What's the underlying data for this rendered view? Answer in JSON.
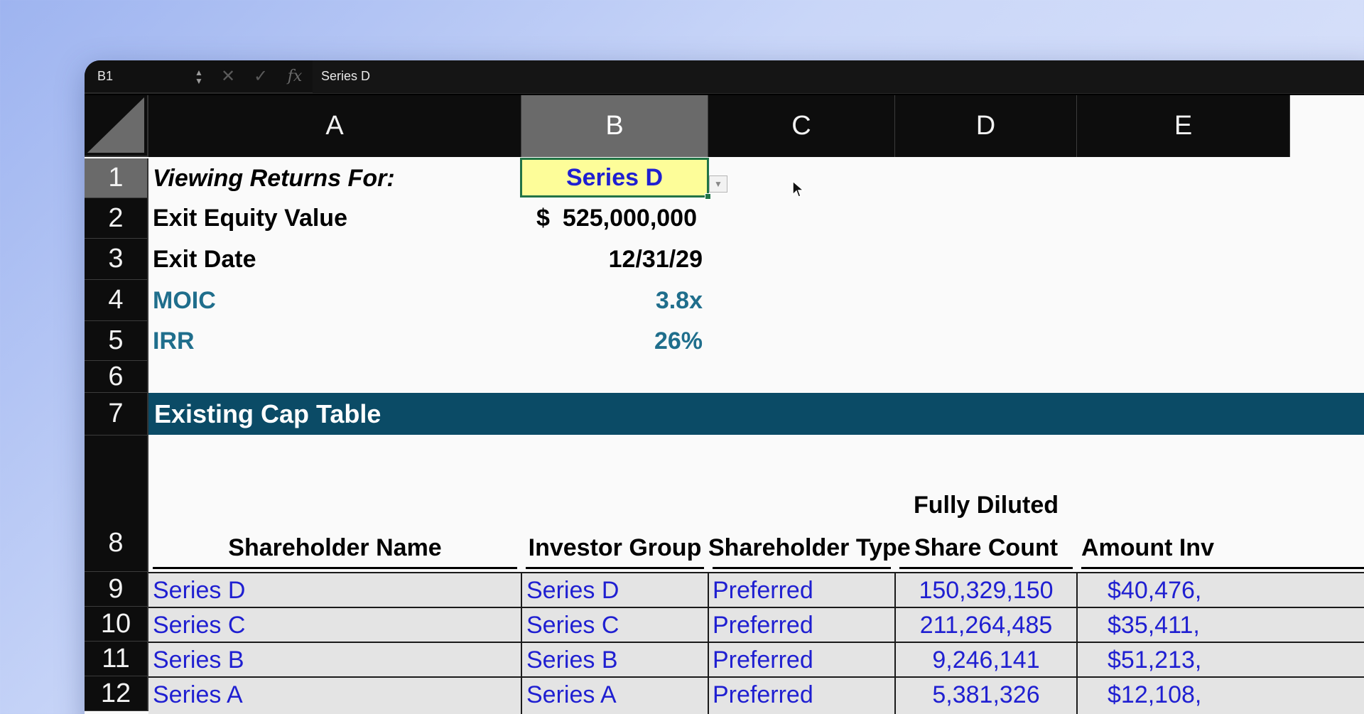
{
  "formula_bar": {
    "name_box": "B1",
    "formula": "Series D"
  },
  "columns": [
    "A",
    "B",
    "C",
    "D",
    "E"
  ],
  "rows": [
    "1",
    "2",
    "3",
    "4",
    "5",
    "6",
    "7",
    "8",
    "9",
    "10",
    "11",
    "12"
  ],
  "summary": {
    "viewing_label": "Viewing Returns For:",
    "viewing_value": "Series D",
    "exit_equity_label": "Exit Equity Value",
    "exit_equity_currency": "$",
    "exit_equity_value": "525,000,000",
    "exit_date_label": "Exit Date",
    "exit_date_value": "12/31/29",
    "moic_label": "MOIC",
    "moic_value": "3.8x",
    "irr_label": "IRR",
    "irr_value": "26%"
  },
  "cap_table": {
    "title": "Existing Cap Table",
    "headers": {
      "name": "Shareholder Name",
      "group": "Investor Group",
      "type": "Shareholder Type",
      "count_line1": "Fully Diluted",
      "count_line2": "Share Count",
      "amount": "Amount Inv"
    },
    "rows": [
      {
        "name": "Series D",
        "group": "Series D",
        "type": "Preferred",
        "count": "150,329,150",
        "amount": "$40,476,"
      },
      {
        "name": "Series C",
        "group": "Series C",
        "type": "Preferred",
        "count": "211,264,485",
        "amount": "$35,411,"
      },
      {
        "name": "Series B",
        "group": "Series B",
        "type": "Preferred",
        "count": "9,246,141",
        "amount": "$51,213,"
      },
      {
        "name": "Series A",
        "group": "Series A",
        "type": "Preferred",
        "count": "5,381,326",
        "amount": "$12,108,"
      }
    ]
  },
  "colors": {
    "banner": "#0b4b66",
    "teal_text": "#1f6e8c",
    "input_blue": "#1f1fd1",
    "selected_fill": "#fdfd99"
  }
}
